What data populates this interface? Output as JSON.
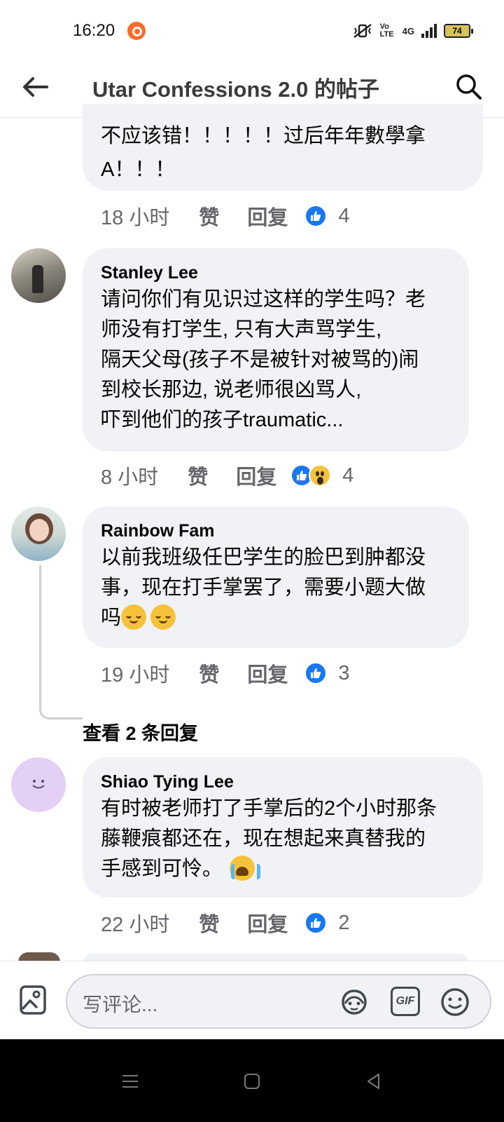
{
  "status_bar": {
    "time": "16:20",
    "volte": "Vo LTE",
    "network": "4G",
    "battery": "74"
  },
  "header": {
    "title": "Utar Confessions 2.0 的帖子",
    "back_icon": "arrow-left-icon",
    "search_icon": "search-icon"
  },
  "comments": [
    {
      "author": "",
      "lines": [
        "不应该错！！！！！过后年年數學拿",
        "A！！！"
      ],
      "time": "18 小时",
      "like_label": "赞",
      "reply_label": "回复",
      "reactions": [
        "like"
      ],
      "reaction_count": "4"
    },
    {
      "author": "Stanley Lee",
      "lines": [
        "请问你们有见识过这样的学生吗？老",
        "师没有打学生, 只有大声骂学生,",
        "隔天父母(孩子不是被针对被骂的)闹",
        "到校长那边, 说老师很凶骂人,",
        "吓到他们的孩子traumatic..."
      ],
      "time": "8 小时",
      "like_label": "赞",
      "reply_label": "回复",
      "reactions": [
        "like",
        "wow"
      ],
      "reaction_count": "4"
    },
    {
      "author": "Rainbow Fam",
      "lines": [
        "以前我班级任巴学生的脸巴到肿都没",
        "事，现在打手掌罢了，需要小题大做",
        "吗"
      ],
      "emojis": [
        "relieved-face",
        "relieved-face"
      ],
      "time": "19 小时",
      "like_label": "赞",
      "reply_label": "回复",
      "reactions": [
        "like"
      ],
      "reaction_count": "3"
    },
    {
      "author": "Shiao Tying Lee",
      "lines": [
        "有时被老师打了手掌后的2个小时那条",
        "藤鞭痕都还在，现在想起来真替我的",
        "手感到可怜。"
      ],
      "emojis": [
        "loudly-crying-face"
      ],
      "time": "22 小时",
      "like_label": "赞",
      "reply_label": "回复",
      "reactions": [
        "like"
      ],
      "reaction_count": "2"
    }
  ],
  "view_replies": "查看 2 条回复",
  "composer": {
    "placeholder": "写评论...",
    "icons": [
      "photo-icon",
      "avatar-sticker-icon",
      "gif-icon",
      "emoji-icon"
    ],
    "gif_label": "GIF"
  },
  "nav_bar": {
    "icons": [
      "menu-icon",
      "home-square-icon",
      "back-triangle-icon"
    ]
  },
  "colors": {
    "like_blue": "#1877f2",
    "bubble_bg": "#f0f2f5",
    "secondary_text": "#65676b"
  }
}
